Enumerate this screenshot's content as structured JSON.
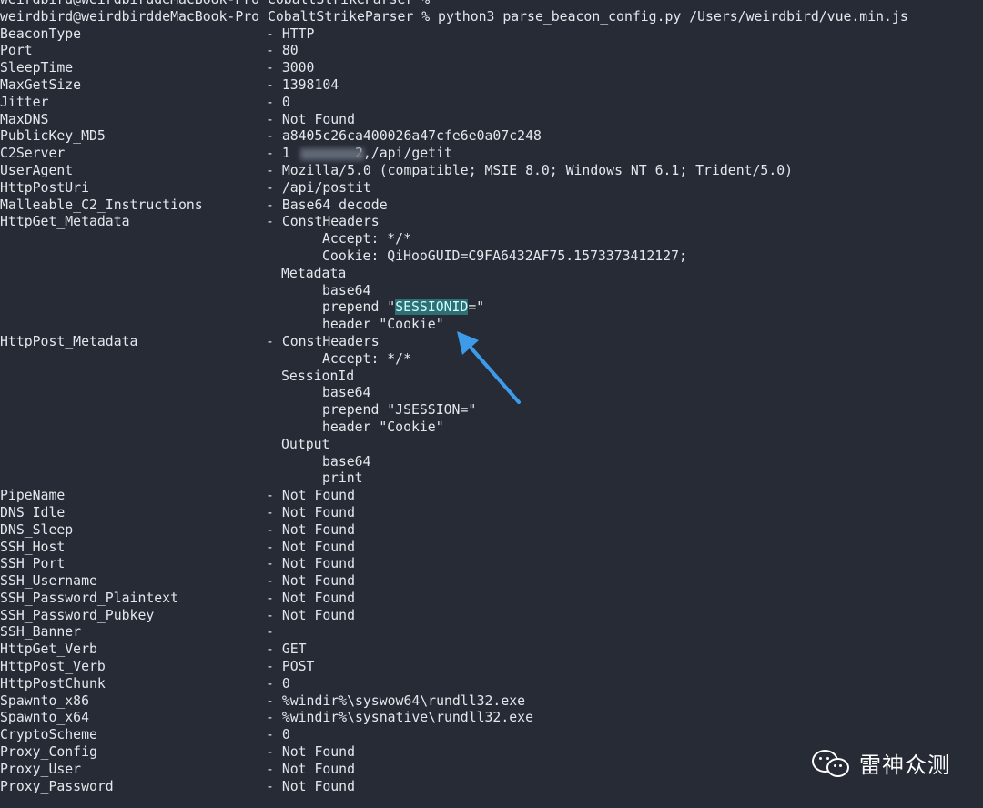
{
  "terminal": {
    "prompt_line_1": "weirdbird@weirdbirddeMacBook-Pro CobaltStrikeParser %",
    "prompt_line_2": "weirdbird@weirdbirddeMacBook-Pro CobaltStrikeParser % python3 parse_beacon_config.py /Users/weirdbird/vue.min.js",
    "rows": [
      {
        "key": "BeaconType",
        "value": "- HTTP"
      },
      {
        "key": "Port",
        "value": "- 80"
      },
      {
        "key": "SleepTime",
        "value": "- 3000"
      },
      {
        "key": "MaxGetSize",
        "value": "- 1398104"
      },
      {
        "key": "Jitter",
        "value": "- 0"
      },
      {
        "key": "MaxDNS",
        "value": "- Not Found"
      },
      {
        "key": "PublicKey_MD5",
        "value": "- a8405c26ca400026a47cfe6e0a07c248"
      },
      {
        "key": "C2Server",
        "value": "- 1        2,/api/getit"
      },
      {
        "key": "UserAgent",
        "value": "- Mozilla/5.0 (compatible; MSIE 8.0; Windows NT 6.1; Trident/5.0)"
      },
      {
        "key": "HttpPostUri",
        "value": "- /api/postit"
      },
      {
        "key": "Malleable_C2_Instructions",
        "value": "- Base64 decode"
      },
      {
        "key": "HttpGet_Metadata",
        "value": "- ConstHeaders"
      }
    ],
    "get_metadata": {
      "accept": "Accept: */*",
      "cookie": "Cookie: QiHooGUID=C9FA6432AF75.1573373412127;",
      "metadata": "Metadata",
      "base64": "base64",
      "prepend_prefix": "prepend \"",
      "prepend_highlight": "SESSIONID",
      "prepend_suffix": "=\"",
      "header": "header \"Cookie\""
    },
    "post_metadata": {
      "key": "HttpPost_Metadata",
      "value": "- ConstHeaders",
      "accept": "Accept: */*",
      "session_id": "SessionId",
      "base64": "base64",
      "prepend": "prepend \"JSESSION=\"",
      "header": "header \"Cookie\"",
      "output": "Output",
      "output_base64": "base64",
      "print": "print"
    },
    "rows_after": [
      {
        "key": "PipeName",
        "value": "- Not Found"
      },
      {
        "key": "DNS_Idle",
        "value": "- Not Found"
      },
      {
        "key": "DNS_Sleep",
        "value": "- Not Found"
      },
      {
        "key": "SSH_Host",
        "value": "- Not Found"
      },
      {
        "key": "SSH_Port",
        "value": "- Not Found"
      },
      {
        "key": "SSH_Username",
        "value": "- Not Found"
      },
      {
        "key": "SSH_Password_Plaintext",
        "value": "- Not Found"
      },
      {
        "key": "SSH_Password_Pubkey",
        "value": "- Not Found"
      },
      {
        "key": "SSH_Banner",
        "value": "-"
      },
      {
        "key": "HttpGet_Verb",
        "value": "- GET"
      },
      {
        "key": "HttpPost_Verb",
        "value": "- POST"
      },
      {
        "key": "HttpPostChunk",
        "value": "- 0"
      },
      {
        "key": "Spawnto_x86",
        "value": "- %windir%\\syswow64\\rundll32.exe"
      },
      {
        "key": "Spawnto_x64",
        "value": "- %windir%\\sysnative\\rundll32.exe"
      },
      {
        "key": "CryptoScheme",
        "value": "- 0"
      },
      {
        "key": "Proxy_Config",
        "value": "- Not Found"
      },
      {
        "key": "Proxy_User",
        "value": "- Not Found"
      },
      {
        "key": "Proxy_Password",
        "value": "- Not Found"
      }
    ]
  },
  "watermark": {
    "text": "雷神众测",
    "icon": "wechat-icon"
  },
  "colors": {
    "background": "#262b36",
    "foreground": "#e4e7ec",
    "highlight_bg": "#2e6f73",
    "arrow": "#3d9be9"
  }
}
